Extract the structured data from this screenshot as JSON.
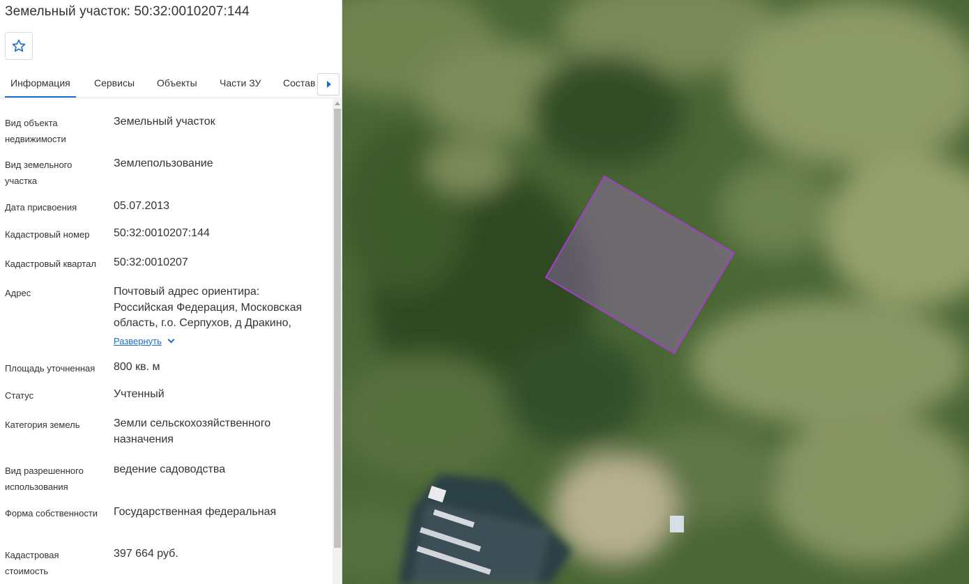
{
  "title": "Земельный участок: 50:32:0010207:144",
  "favorite_icon": "star-outline-icon",
  "tabs": [
    {
      "label": "Информация",
      "active": true
    },
    {
      "label": "Сервисы"
    },
    {
      "label": "Объекты"
    },
    {
      "label": "Части ЗУ"
    },
    {
      "label": "Состав"
    }
  ],
  "tabs_next_icon": "caret-right-icon",
  "properties": {
    "object_type": {
      "label": "Вид объекта недвижимости",
      "value": "Земельный участок"
    },
    "plot_type": {
      "label": "Вид земельного участка",
      "value": "Землепользование"
    },
    "assigned_date": {
      "label": "Дата присвоения",
      "value": "05.07.2013"
    },
    "cadastral_number": {
      "label": "Кадастровый номер",
      "value": "50:32:0010207:144"
    },
    "cadastral_quarter": {
      "label": "Кадастровый квартал",
      "value": "50:32:0010207"
    },
    "address": {
      "label": "Адрес",
      "value": "Почтовый адрес ориентира: Российская Федерация, Московская область, г.о. Серпухов, д Дракино,",
      "expand_label": "Развернуть"
    },
    "area": {
      "label": "Площадь уточненная",
      "value": "800 кв. м"
    },
    "status": {
      "label": "Статус",
      "value": "Учтенный"
    },
    "land_category": {
      "label": "Категория земель",
      "value": "Земли сельскохозяйственного назначения"
    },
    "permitted_use": {
      "label": "Вид разрешенного использования",
      "value": "ведение садоводства"
    },
    "ownership": {
      "label": "Форма собственности",
      "value": "Государственная федеральная"
    },
    "cadastral_value": {
      "label": "Кадастровая стоимость",
      "value": "397 664 руб."
    }
  },
  "colors": {
    "accent": "#1a6dc8",
    "parcel_outline": "#a43ec9",
    "parcel_fill": "#9a6fb8"
  }
}
